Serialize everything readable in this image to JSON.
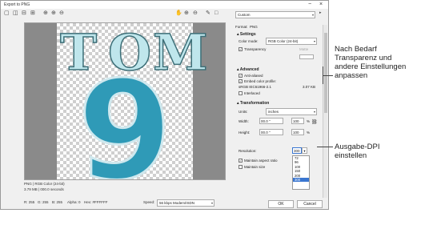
{
  "window": {
    "title": "Export to PNG",
    "minimize": "−",
    "close": "×"
  },
  "toolbar": {
    "icons": [
      "single-view-icon",
      "split-view-vertical-icon",
      "split-view-horizontal-icon",
      "quad-view-icon",
      "zoom-icon",
      "zoom-in-icon",
      "zoom-out-icon",
      "pan-icon",
      "zoom-fit-icon",
      "zoom-one-icon",
      "eyedropper-icon",
      "background-color-icon"
    ],
    "preset": "Custom"
  },
  "preview": {
    "letters": [
      "T",
      "O",
      "M"
    ],
    "number": "9"
  },
  "info": {
    "line1": "PNG  |  RGB Color (24-bit)",
    "line2": "3.79 MB  |  000.0 seconds"
  },
  "panel": {
    "format_label": "Format:",
    "format_value": "PNG",
    "settings_title": "Settings",
    "color_mode_label": "Color mode:",
    "color_mode_value": "RGB Color (24-bit)",
    "transparency_label": "Transparency",
    "matte_label": "Matte",
    "advanced_title": "Advanced",
    "anti_aliased": "Anti-aliased",
    "embed_profile": "Embed color profile:",
    "profile_name": "sRGB IEC61966-2.1",
    "profile_size": "3.07 KB",
    "interlaced": "Interlaced",
    "transformation_title": "Transformation",
    "units_label": "Units:",
    "units_value": "inches",
    "width_label": "Width:",
    "width_value": "00.0 \"",
    "width_pct": "100",
    "height_label": "Height:",
    "height_value": "00.0 \"",
    "height_pct": "100",
    "pct": "%",
    "resolution_label": "Resolution:",
    "resolution_value": "300",
    "maintain_aspect": "Maintain aspect ratio",
    "maintain_size": "Maintain size",
    "resolution_options": [
      "72",
      "96",
      "100",
      "150",
      "200",
      "300"
    ]
  },
  "status": {
    "r": "R: 255",
    "g": "G: 255",
    "b": "B: 255",
    "alpha": "Alpha: 0",
    "hex": "Hex: #FFFFFF",
    "speed_label": "Speed:",
    "speed_value": "56 kbps Modem/ISDN"
  },
  "buttons": {
    "ok": "OK",
    "cancel": "Cancel"
  },
  "callouts": {
    "top": [
      "Nach Bedarf",
      "Transparenz und",
      "andere Einstellungen",
      "anpassen"
    ],
    "bottom": [
      "Ausgabe-DPI",
      "einstellen"
    ]
  }
}
